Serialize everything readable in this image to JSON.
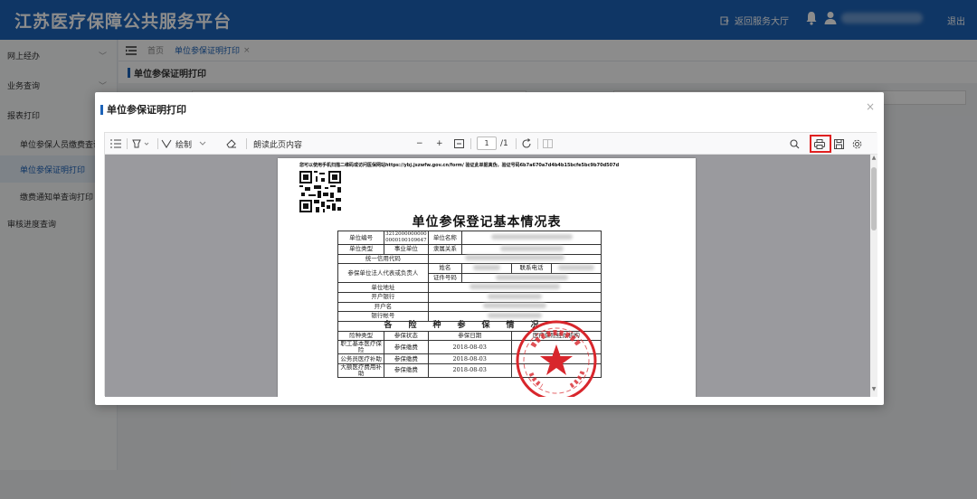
{
  "header": {
    "title": "江苏医疗保障公共服务平台",
    "return_label": "返回服务大厅",
    "logout_label": "退出"
  },
  "sidebar": {
    "items": [
      {
        "label": "网上经办",
        "chevron": "﹀"
      },
      {
        "label": "业务查询",
        "chevron": "﹀"
      },
      {
        "label": "报表打印",
        "chevron": ""
      },
      {
        "label": "单位参保人员缴费查询",
        "chevron": ""
      },
      {
        "label": "单位参保证明打印",
        "chevron": ""
      },
      {
        "label": "缴费通知单查询打印",
        "chevron": ""
      },
      {
        "label": "审核进度查询",
        "chevron": ""
      }
    ]
  },
  "tabs": {
    "home": "首页",
    "active": "单位参保证明打印",
    "close": "×"
  },
  "page": {
    "heading": "单位参保证明打印"
  },
  "modal": {
    "title": "单位参保证明打印",
    "close": "×"
  },
  "viewer": {
    "draw_label": "绘制",
    "read_label": "朗读此页内容",
    "page_current": "1",
    "page_total": "/1",
    "zoom_minus": "−",
    "zoom_plus": "+"
  },
  "document": {
    "verify_text": "您可以使用手机扫描二维码或访问医保网站https://ybj.jszwfw.gov.cn/form/ 验证此单据真伪，验证号码6b7a670a7d4b4b15bcfe5bc9b70d507d",
    "title": "单位参保登记基本情况表",
    "labels": {
      "unit_no": "单位编号",
      "unit_no_value": "3212000000000 0000100109647",
      "unit_name": "单位名称",
      "unit_type": "单位类型",
      "unit_type_value": "事业单位",
      "affiliation": "隶属关系",
      "credit_code": "统一信用代码",
      "legal_rep": "参保单位法人代表或负责人",
      "name": "姓名",
      "phone": "联系电话",
      "cert_no": "证件号码",
      "address": "单位地址",
      "bank": "开户银行",
      "account_name": "开户名",
      "account_no": "银行帐号",
      "section": "各险种参保情况",
      "col_type": "险种类型",
      "col_status": "参保状态",
      "col_date": "参保日期",
      "col_agency": "医疗保险经办机构"
    },
    "rows": [
      {
        "type": "职工基本医疗保险",
        "status": "参保缴费",
        "date": "2018-08-03"
      },
      {
        "type": "公务员医疗补助",
        "status": "参保缴费",
        "date": "2018-08-03"
      },
      {
        "type": "大额医疗费用补助",
        "status": "参保缴费",
        "date": "2018-08-03"
      }
    ]
  },
  "colors": {
    "header_bg": "#1d63b8",
    "accent": "#1d63b8",
    "highlight": "#e02020",
    "stamp": "#d8262c"
  },
  "icons": [
    "list-icon",
    "highlight-icon",
    "draw-icon",
    "eraser-icon",
    "fit-page-icon",
    "rotate-icon",
    "search-icon",
    "print-icon",
    "save-icon",
    "settings-icon",
    "bell-icon",
    "user-icon",
    "exit-icon"
  ]
}
